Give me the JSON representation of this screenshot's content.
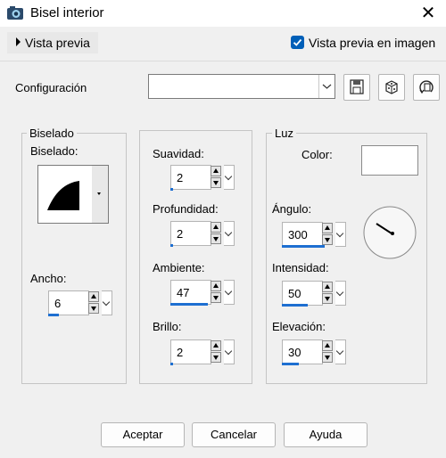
{
  "window": {
    "title": "Bisel interior",
    "close_icon": "close-icon"
  },
  "preview": {
    "toggle_label": "Vista previa",
    "checkbox_label": "Vista previa en imagen",
    "checked": true
  },
  "config": {
    "label": "Configuración",
    "value": ""
  },
  "bevel": {
    "group": "Biselado",
    "label": "Biselado:",
    "width_label": "Ancho:",
    "width_value": "6",
    "width_level": 0.2
  },
  "params": {
    "smoothness": {
      "label": "Suavidad:",
      "value": "2",
      "level": 0.05
    },
    "depth": {
      "label": "Profundidad:",
      "value": "2",
      "level": 0.05
    },
    "ambient": {
      "label": "Ambiente:",
      "value": "47",
      "level": 0.73
    },
    "shininess": {
      "label": "Brillo:",
      "value": "2",
      "level": 0.05
    }
  },
  "light": {
    "group": "Luz",
    "color_label": "Color:",
    "color": "#ffffff",
    "angle": {
      "label": "Ángulo:",
      "value": "300",
      "level": 0.83
    },
    "intensity": {
      "label": "Intensidad:",
      "value": "50",
      "level": 0.5
    },
    "elevation": {
      "label": "Elevación:",
      "value": "30",
      "level": 0.33
    }
  },
  "buttons": {
    "ok": "Aceptar",
    "cancel": "Cancelar",
    "help": "Ayuda"
  },
  "colors": {
    "accent": "#005fb8",
    "bar": "#1e6fd1"
  }
}
